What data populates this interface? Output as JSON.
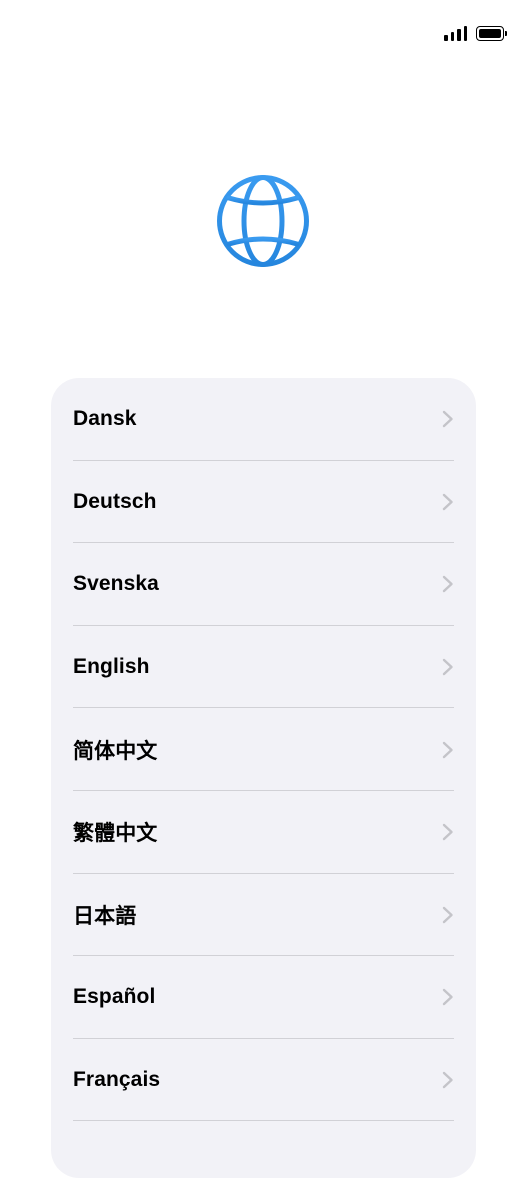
{
  "status_bar": {
    "signal_icon": "cellular-signal-icon",
    "battery_icon": "battery-full-icon"
  },
  "header": {
    "icon": "globe-icon",
    "accent_color": "#2f8fe8"
  },
  "language_list": {
    "items": [
      {
        "label": "Dansk"
      },
      {
        "label": "Deutsch"
      },
      {
        "label": "Svenska"
      },
      {
        "label": "English"
      },
      {
        "label": "简体中文"
      },
      {
        "label": "繁體中文"
      },
      {
        "label": "日本語"
      },
      {
        "label": "Español"
      },
      {
        "label": "Français"
      }
    ]
  }
}
